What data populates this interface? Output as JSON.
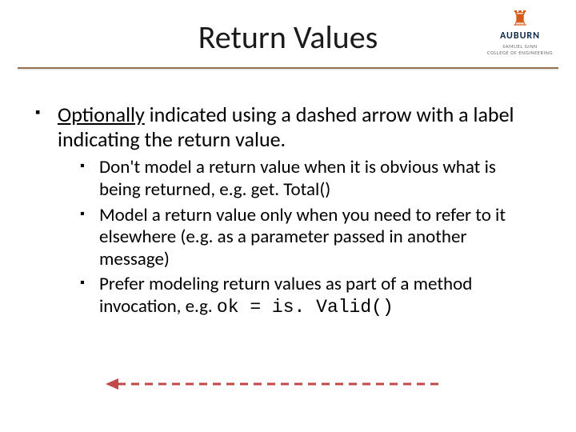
{
  "title": "Return Values",
  "logo": {
    "university": "AUBURN",
    "department_line1": "SAMUEL GINN",
    "department_line2": "COLLEGE OF ENGINEERING"
  },
  "bullet": {
    "lead": "Optionally",
    "rest": " indicated using a dashed arrow with a label indicating the return value."
  },
  "subbullets": [
    "Don't model a return value when it is obvious what is being returned, e.g. get. Total()",
    "Model a return value only when you need to refer to it elsewhere (e.g. as a parameter passed in another message)"
  ],
  "subbullet3": {
    "pre": "Prefer modeling return values as part of a method invocation, e.g. ",
    "code": "ok = is. Valid()"
  },
  "arrow": {
    "color": "#c04848"
  }
}
